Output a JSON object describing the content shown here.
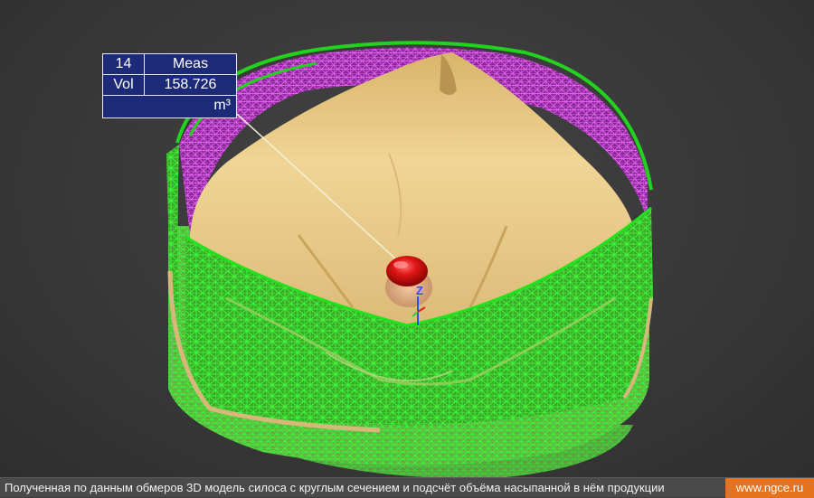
{
  "measurement": {
    "id": "14",
    "type": "Meas",
    "label": "Vol",
    "value": "158.726",
    "unit": "m³"
  },
  "axis": {
    "z_label": "Z"
  },
  "caption": {
    "text": "Полученная по данным обмеров 3D модель силоса с круглым сечением и подсчёт объёма насыпанной в нём продукции",
    "site": "www.ngce.ru"
  },
  "colors": {
    "background": "#3c3c3c",
    "mesh_green": "#22d21e",
    "mesh_magenta": "#c93ad4",
    "grain_surface": "#e6c57e",
    "marker_red": "#e01515",
    "label_box": "#1d2a78",
    "site_badge": "#e5721e"
  }
}
